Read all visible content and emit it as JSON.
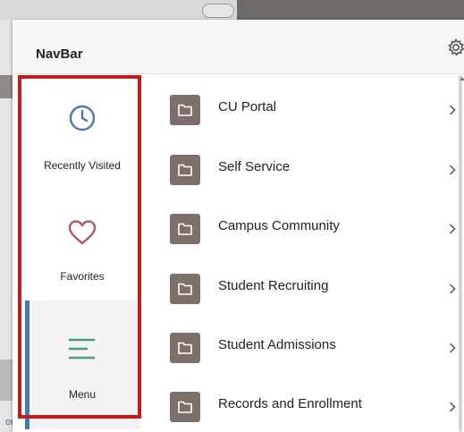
{
  "navbar": {
    "title": "NavBar",
    "gear_icon": "gear-icon"
  },
  "left_nav": {
    "items": [
      {
        "label": "Recently Visited",
        "icon": "clock-icon"
      },
      {
        "label": "Favorites",
        "icon": "heart-icon"
      },
      {
        "label": "Menu",
        "icon": "menu-lines-icon",
        "selected": true
      }
    ]
  },
  "menu_list": {
    "items": [
      {
        "label": "CU Portal",
        "icon": "folder-icon"
      },
      {
        "label": "Self Service",
        "icon": "folder-icon"
      },
      {
        "label": "Campus Community",
        "icon": "folder-icon"
      },
      {
        "label": "Student Recruiting",
        "icon": "folder-icon"
      },
      {
        "label": "Student Admissions",
        "icon": "folder-icon"
      },
      {
        "label": "Records and Enrollment",
        "icon": "folder-icon"
      }
    ]
  },
  "background": {
    "corner_text": "om"
  },
  "colors": {
    "highlight_border": "#c41c1c",
    "folder_tile": "#7d706a",
    "accent_blue": "#3d7ab8",
    "heart": "#b05a63",
    "menu_lines": "#4a9a8f",
    "clock": "#4a78b5"
  }
}
